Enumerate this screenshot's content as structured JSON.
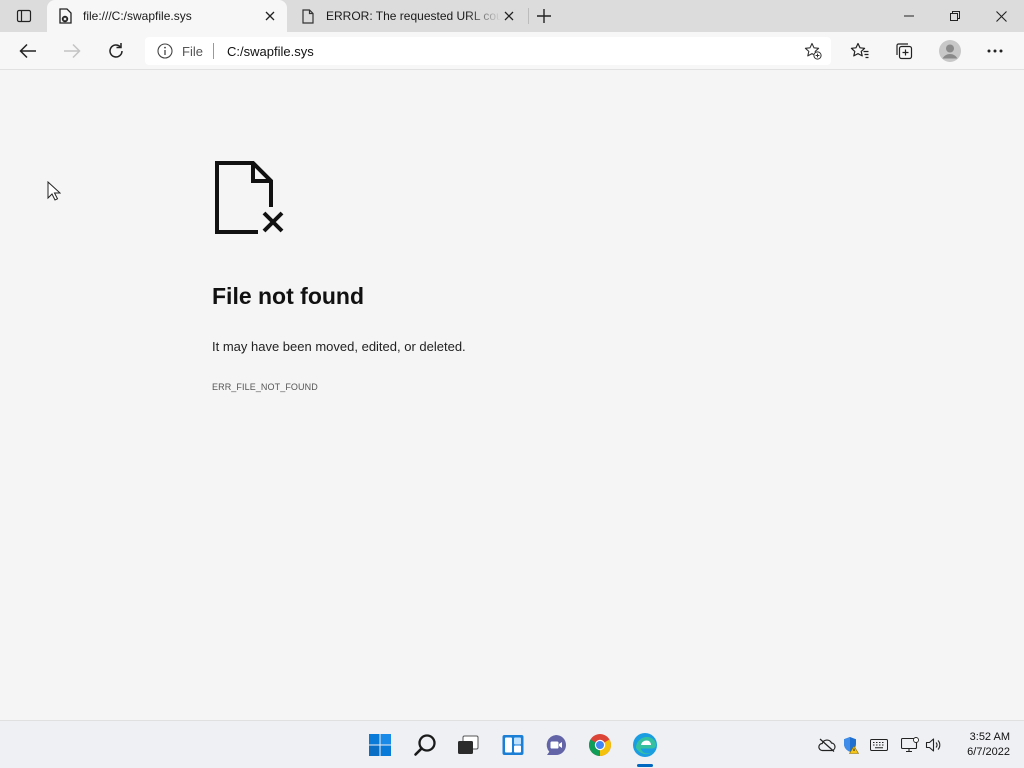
{
  "browser": {
    "tabs": [
      {
        "title": "file:///C:/swapfile.sys",
        "active": true
      },
      {
        "title": "ERROR: The requested URL could not be retrieved",
        "active": false
      }
    ],
    "address": {
      "scheme_label": "File",
      "url": "C:/swapfile.sys"
    }
  },
  "error_page": {
    "title": "File not found",
    "description": "It may have been moved, edited, or deleted.",
    "code": "ERR_FILE_NOT_FOUND"
  },
  "taskbar": {
    "apps": [
      "start-icon",
      "search-icon",
      "task-view-icon",
      "widgets-icon",
      "chat-icon",
      "chrome-icon",
      "edge-icon"
    ],
    "clock": {
      "time": "3:52 AM",
      "date": "6/7/2022"
    }
  },
  "colors": {
    "accent": "#0067c0",
    "page_bg": "#f5f5f5",
    "tabstrip_bg": "#dcdcdc"
  }
}
